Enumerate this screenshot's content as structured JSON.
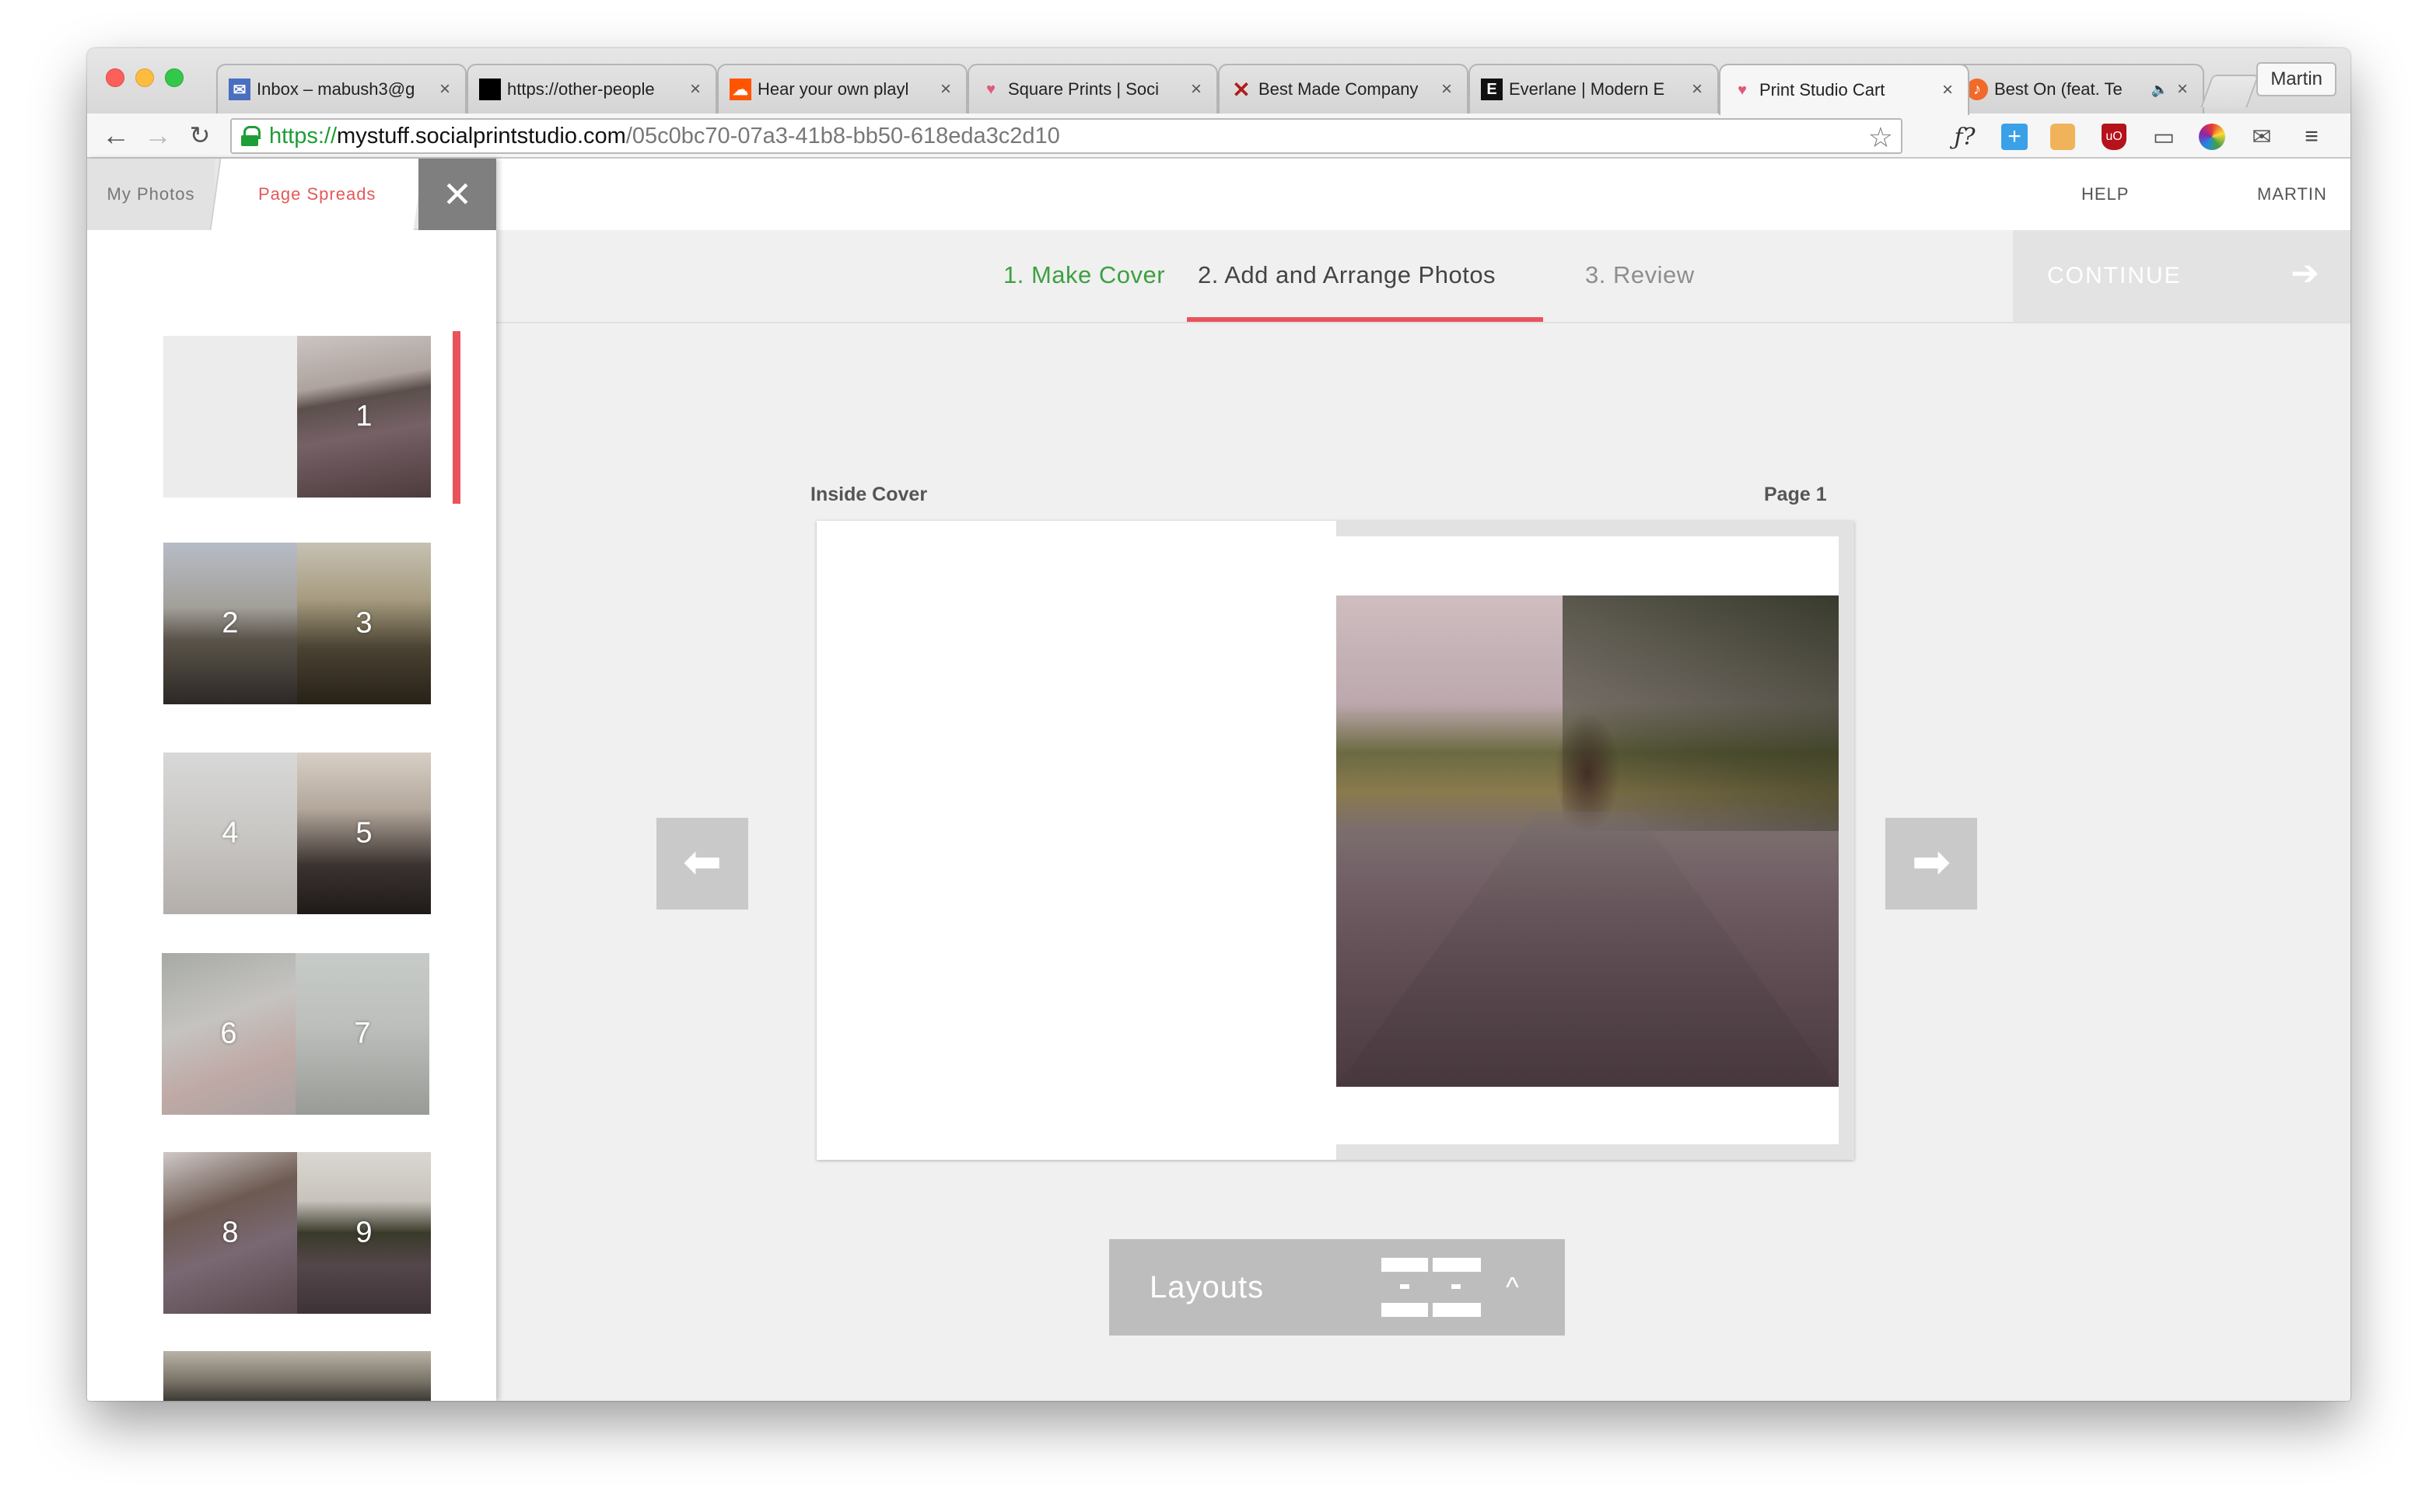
{
  "browser": {
    "tabs": [
      {
        "title": "Inbox – mabush3@g",
        "icon": "inbox-icon",
        "fav_text": "✉",
        "fav_bg": "#4a6fc0",
        "active": false
      },
      {
        "title": "https://other-people",
        "icon": "black-square-icon",
        "fav_text": "",
        "fav_bg": "#000000",
        "active": false
      },
      {
        "title": "Hear your own playl",
        "icon": "soundcloud-icon",
        "fav_text": "☁",
        "fav_bg": "#ff5500",
        "active": false
      },
      {
        "title": "Square Prints | Soci",
        "icon": "heart-colorful-icon",
        "fav_text": "♥",
        "fav_bg": "#e05a7a",
        "active": false
      },
      {
        "title": "Best Made Company",
        "icon": "red-x-icon",
        "fav_text": "✕",
        "fav_bg": "#b01c1c",
        "active": false
      },
      {
        "title": "Everlane | Modern E",
        "icon": "everlane-e-icon",
        "fav_text": "E",
        "fav_bg": "#111111",
        "active": false
      },
      {
        "title": "Print Studio Cart",
        "icon": "heart-colorful-icon",
        "fav_text": "♥",
        "fav_bg": "#e05a7a",
        "active": true
      },
      {
        "title": "Best On (feat. Te",
        "icon": "music-icon",
        "fav_text": "♪",
        "fav_bg": "#f06a2a",
        "active": false,
        "audio": true
      }
    ],
    "profile_name": "Martin",
    "url": {
      "scheme": "https://",
      "host": "mystuff.socialprintstudio.com",
      "path": "/05c0bc70-07a3-41b8-bb50-618eda3c2d10"
    }
  },
  "sidebar": {
    "tab_my_photos": "My Photos",
    "tab_page_spreads": "Page Spreads",
    "close_symbol": "✕",
    "spreads": [
      {
        "left_num": "",
        "right_num": "1",
        "left_photo": "blank",
        "right_photo": "road"
      },
      {
        "left_num": "2",
        "right_num": "3",
        "left_photo": "lake",
        "right_photo": "dock"
      },
      {
        "left_num": "4",
        "right_num": "5",
        "left_photo": "mist",
        "right_photo": "water"
      },
      {
        "left_num": "6",
        "right_num": "7",
        "left_photo": "blur",
        "right_photo": "blur"
      },
      {
        "left_num": "8",
        "right_num": "9",
        "left_photo": "road",
        "right_photo": "road"
      }
    ]
  },
  "header": {
    "help": "HELP",
    "user": "MARTIN"
  },
  "steps": {
    "step1": "1.  Make Cover",
    "step2": "2.  Add and Arrange Photos",
    "step3": "3.  Review",
    "continue": "CONTINUE",
    "continue_arrow": "➔"
  },
  "editor": {
    "left_label": "Inside Cover",
    "right_label": "Page 1",
    "prev_arrow": "⬅",
    "next_arrow": "➡",
    "layouts_label": "Layouts",
    "layouts_chevron": "^"
  },
  "colors": {
    "accent_red": "#e9535b",
    "step_done_green": "#3ea042"
  }
}
